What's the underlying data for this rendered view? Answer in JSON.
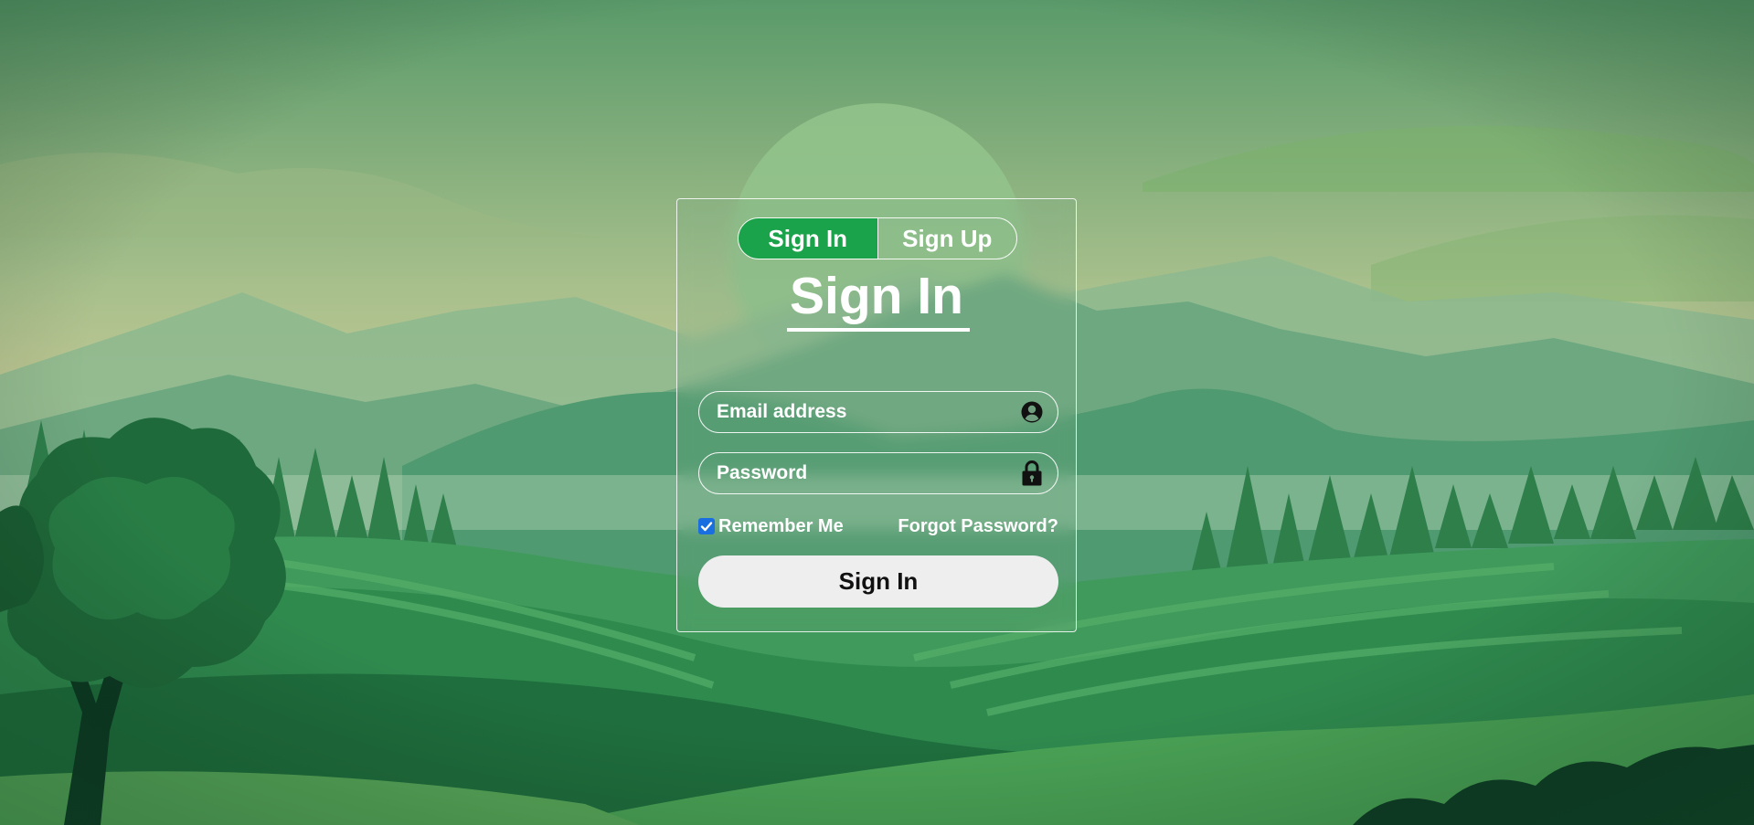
{
  "auth_tabs": [
    {
      "label": "Sign In",
      "active": true
    },
    {
      "label": "Sign Up",
      "active": false
    }
  ],
  "form": {
    "heading": "Sign In",
    "email": {
      "placeholder": "Email address",
      "value": "",
      "icon": "user-circle-icon"
    },
    "password": {
      "placeholder": "Password",
      "value": "",
      "icon": "lock-icon"
    },
    "remember_label": "Remember Me",
    "remember_checked": true,
    "forgot_label": "Forgot Password?",
    "submit_label": "Sign In"
  },
  "colors": {
    "accent": "#1aa34a",
    "checkbox": "#1a6fe0",
    "submit_bg": "#efeeef"
  }
}
